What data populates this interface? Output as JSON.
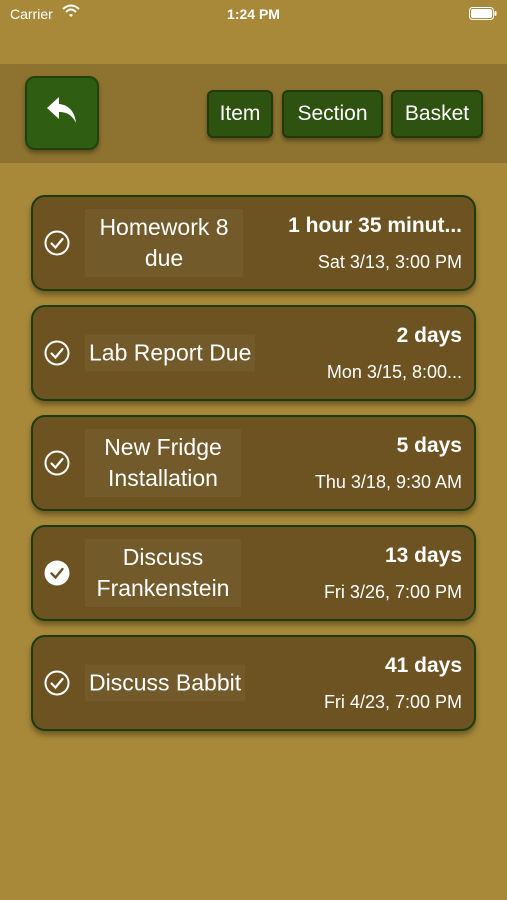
{
  "status_bar": {
    "carrier": "Carrier",
    "time": "1:24 PM"
  },
  "toolbar": {
    "back_icon": "reply-arrow-icon",
    "item_label": "Item",
    "section_label": "Section",
    "basket_label": "Basket"
  },
  "colors": {
    "background": "#a8893a",
    "toolbar": "#8e7330",
    "card": "#6d5321",
    "button_green": "#2e520f"
  },
  "items": [
    {
      "title": "Homework 8 due",
      "countdown": "1 hour 35 minut...",
      "datetime": "Sat 3/13, 3:00 PM",
      "completed": false
    },
    {
      "title": "Lab Report Due",
      "countdown": "2 days",
      "datetime": "Mon 3/15, 8:00...",
      "completed": false
    },
    {
      "title": "New Fridge Installation",
      "countdown": "5 days",
      "datetime": "Thu 3/18, 9:30 AM",
      "completed": false
    },
    {
      "title": "Discuss Frankenstein",
      "countdown": "13 days",
      "datetime": "Fri 3/26, 7:00 PM",
      "completed": true
    },
    {
      "title": "Discuss Babbit",
      "countdown": "41 days",
      "datetime": "Fri 4/23, 7:00 PM",
      "completed": false
    }
  ]
}
